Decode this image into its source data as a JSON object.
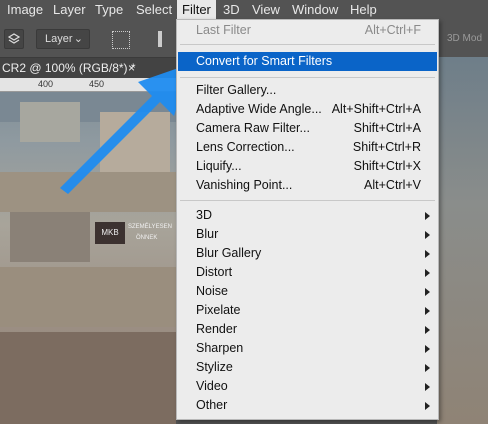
{
  "menubar": {
    "items": [
      {
        "label": "Image",
        "open": false
      },
      {
        "label": "Layer",
        "open": false
      },
      {
        "label": "Type",
        "open": false
      },
      {
        "label": "Select",
        "open": false
      },
      {
        "label": "Filter",
        "open": true
      },
      {
        "label": "3D",
        "open": false
      },
      {
        "label": "View",
        "open": false
      },
      {
        "label": "Window",
        "open": false
      },
      {
        "label": "Help",
        "open": false
      }
    ]
  },
  "options_bar": {
    "layer_select": "Layer",
    "mode_3d_label": "3D Mod"
  },
  "document": {
    "tab_title": "CR2 @ 100% (RGB/8*) *",
    "tab_close": "×",
    "ruler_marks": [
      "400",
      "450"
    ],
    "sign_text_1": "MKB",
    "sign_text_2": "SZEMÉLYESEN",
    "sign_text_3": "ÖNNEK"
  },
  "filter_menu": {
    "items": [
      {
        "label": "Last Filter",
        "shortcut": "Alt+Ctrl+F",
        "disabled": true
      },
      {
        "label": "Convert for Smart Filters",
        "shortcut": "",
        "highlighted": true
      },
      {
        "label": "Filter Gallery...",
        "shortcut": ""
      },
      {
        "label": "Adaptive Wide Angle...",
        "shortcut": "Alt+Shift+Ctrl+A"
      },
      {
        "label": "Camera Raw Filter...",
        "shortcut": "Shift+Ctrl+A"
      },
      {
        "label": "Lens Correction...",
        "shortcut": "Shift+Ctrl+R"
      },
      {
        "label": "Liquify...",
        "shortcut": "Shift+Ctrl+X"
      },
      {
        "label": "Vanishing Point...",
        "shortcut": "Alt+Ctrl+V"
      },
      {
        "label": "3D",
        "submenu": true
      },
      {
        "label": "Blur",
        "submenu": true
      },
      {
        "label": "Blur Gallery",
        "submenu": true
      },
      {
        "label": "Distort",
        "submenu": true
      },
      {
        "label": "Noise",
        "submenu": true
      },
      {
        "label": "Pixelate",
        "submenu": true
      },
      {
        "label": "Render",
        "submenu": true
      },
      {
        "label": "Sharpen",
        "submenu": true
      },
      {
        "label": "Stylize",
        "submenu": true
      },
      {
        "label": "Video",
        "submenu": true
      },
      {
        "label": "Other",
        "submenu": true
      }
    ]
  },
  "colors": {
    "highlight": "#0a64c8",
    "arrow": "#1f8cf0"
  }
}
